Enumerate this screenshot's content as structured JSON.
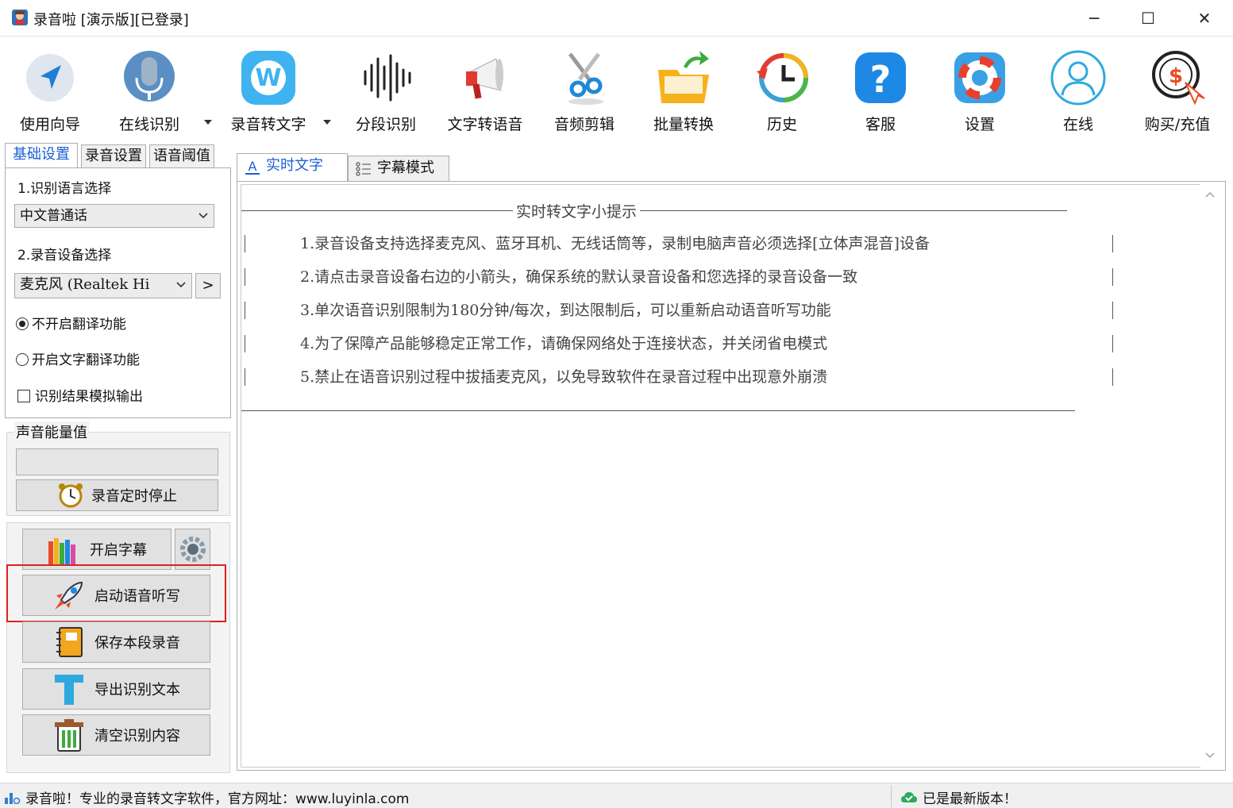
{
  "window": {
    "title": "录音啦 [演示版][已登录]",
    "minimize_glyph": "─",
    "maximize_glyph": "☐",
    "close_glyph": "✕"
  },
  "toolbar": {
    "items": [
      {
        "label": "使用向导",
        "icon": "navigation-arrow-icon"
      },
      {
        "label": "在线识别",
        "icon": "microphone-icon"
      },
      {
        "label": "录音转文字",
        "icon": "w-app-icon"
      },
      {
        "label": "分段识别",
        "icon": "waveform-icon"
      },
      {
        "label": "文字转语音",
        "icon": "megaphone-icon"
      },
      {
        "label": "音频剪辑",
        "icon": "scissors-icon"
      },
      {
        "label": "批量转换",
        "icon": "folder-convert-icon"
      },
      {
        "label": "历史",
        "icon": "history-clock-icon"
      },
      {
        "label": "客服",
        "icon": "help-question-icon"
      },
      {
        "label": "设置",
        "icon": "lifebuoy-settings-icon"
      },
      {
        "label": "在线",
        "icon": "user-online-icon"
      },
      {
        "label": "购买/充值",
        "icon": "purchase-coin-icon"
      }
    ]
  },
  "left_tabs": [
    "基础设置",
    "录音设置",
    "语音阈值"
  ],
  "basic_settings": {
    "language_label": "1.识别语言选择",
    "language_value": "中文普通话",
    "device_label": "2.录音设备选择",
    "device_value": "麦克风 (Realtek Hi",
    "device_next": ">",
    "no_translate": "不开启翻译功能",
    "translate": "开启文字翻译功能",
    "simulate_output": "识别结果模拟输出"
  },
  "energy": {
    "title": "声音能量值",
    "level": 0,
    "timer_stop": "录音定时停止"
  },
  "actions": {
    "subtitle": "开启字幕",
    "start_dictation": "启动语音听写",
    "save_segment": "保存本段录音",
    "export_text": "导出识别文本",
    "clear_content": "清空识别内容"
  },
  "right_tabs": [
    "实时文字",
    "字幕模式"
  ],
  "hints": {
    "title": "实时转文字小提示",
    "lines": [
      "1.录音设备支持选择麦克风、蓝牙耳机、无线话筒等，录制电脑声音必须选择[立体声混音]设备",
      "2.请点击录音设备右边的小箭头，确保系统的默认录音设备和您选择的录音设备一致",
      "3.单次语音识别限制为180分钟/每次，到达限制后，可以重新启动语音听写功能",
      "4.为了保障产品能够稳定正常工作，请确保网络处于连接状态，并关闭省电模式",
      "5.禁止在语音识别过程中拔插麦克风，以免导致软件在录音过程中出现意外崩溃"
    ]
  },
  "status": {
    "left": "录音啦！专业的录音转文字软件，官方网址：www.luyinla.com",
    "right": "已是最新版本！"
  },
  "colors": {
    "accent_blue": "#1a5fd6",
    "highlight_red": "#e02020"
  }
}
